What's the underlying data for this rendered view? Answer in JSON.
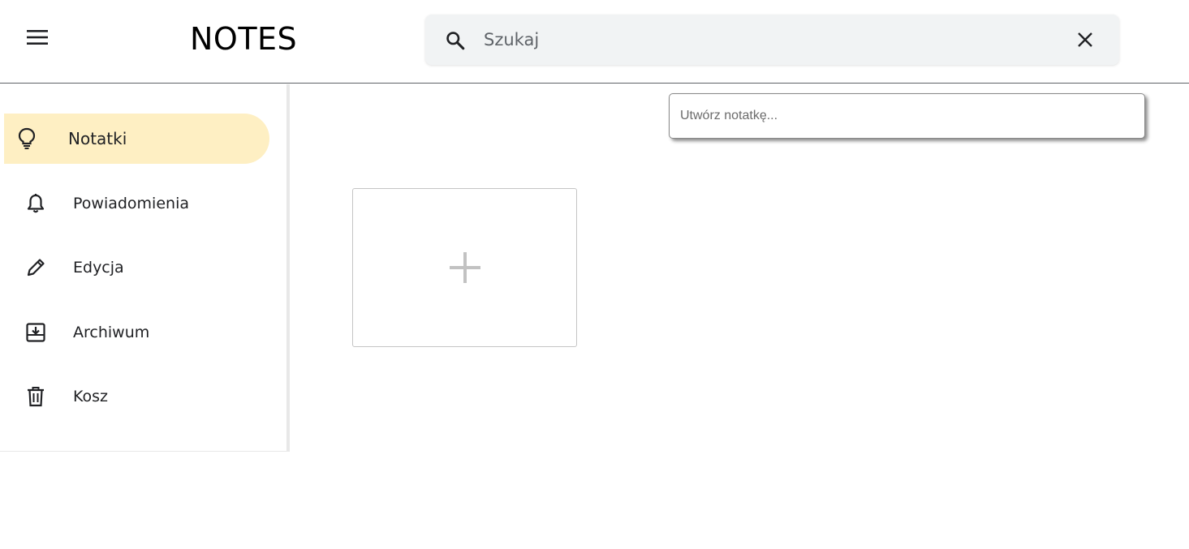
{
  "header": {
    "menu_icon": "hamburger-menu-icon",
    "title": "NOTES",
    "search": {
      "placeholder": "Szukaj",
      "value": "",
      "search_icon": "search-icon",
      "clear_icon": "close-icon"
    }
  },
  "sidebar": {
    "items": [
      {
        "label": "Notatki",
        "icon": "lightbulb-icon",
        "active": true
      },
      {
        "label": "Powiadomienia",
        "icon": "bell-icon",
        "active": false
      },
      {
        "label": "Edycja",
        "icon": "pencil-icon",
        "active": false
      },
      {
        "label": "Archiwum",
        "icon": "archive-icon",
        "active": false
      },
      {
        "label": "Kosz",
        "icon": "trash-icon",
        "active": false
      }
    ],
    "active_color": "#feefc3"
  },
  "main": {
    "create_note": {
      "placeholder": "Utwórz notatkę...",
      "value": ""
    },
    "add_card_icon": "plus-icon"
  }
}
